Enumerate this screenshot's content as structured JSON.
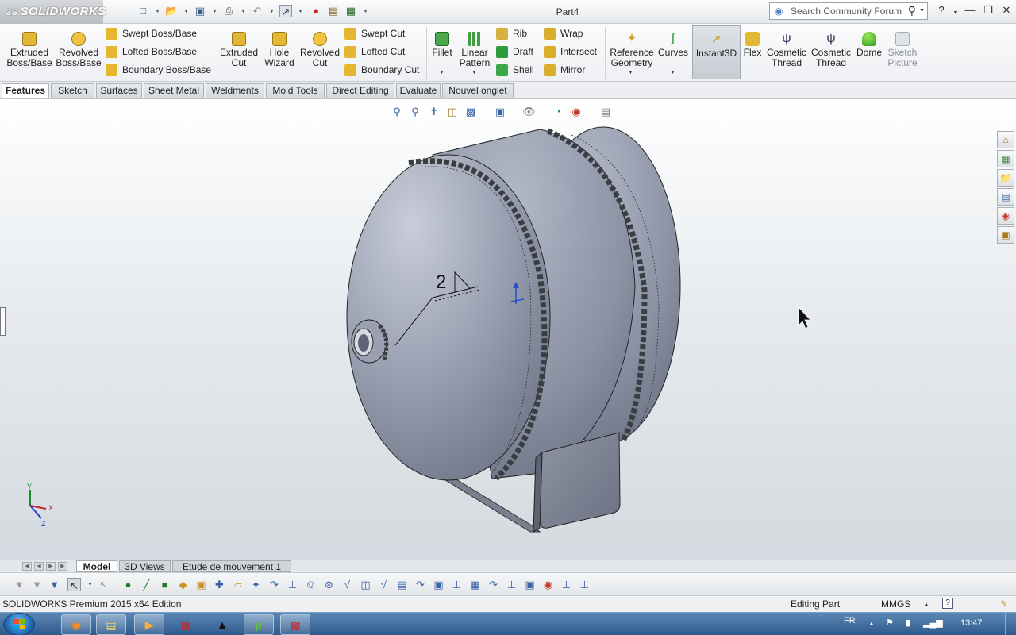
{
  "app": {
    "logo_text": "SOLIDWORKS",
    "logo_prefix": "3S",
    "document_title": "Part4",
    "search_placeholder": "Search Community Forum"
  },
  "ribbon": {
    "big_buttons": [
      {
        "id": "extruded-boss-base",
        "label": "Extruded\nBoss/Base"
      },
      {
        "id": "revolved-boss-base",
        "label": "Revolved\nBoss/Base"
      },
      {
        "id": "extruded-cut",
        "label": "Extruded\nCut"
      },
      {
        "id": "hole-wizard",
        "label": "Hole\nWizard"
      },
      {
        "id": "revolved-cut",
        "label": "Revolved\nCut"
      },
      {
        "id": "fillet",
        "label": "Fillet"
      },
      {
        "id": "linear-pattern",
        "label": "Linear\nPattern"
      },
      {
        "id": "reference-geometry",
        "label": "Reference\nGeometry"
      },
      {
        "id": "curves",
        "label": "Curves"
      },
      {
        "id": "instant3d",
        "label": "Instant3D"
      },
      {
        "id": "flex",
        "label": "Flex"
      },
      {
        "id": "cosmetic-thread-1",
        "label": "Cosmetic\nThread"
      },
      {
        "id": "cosmetic-thread-2",
        "label": "Cosmetic\nThread"
      },
      {
        "id": "dome",
        "label": "Dome"
      },
      {
        "id": "sketch-picture",
        "label": "Sketch\nPicture"
      }
    ],
    "small_buttons": {
      "swept_boss": "Swept Boss/Base",
      "lofted_boss": "Lofted Boss/Base",
      "boundary_boss": "Boundary Boss/Base",
      "swept_cut": "Swept Cut",
      "lofted_cut": "Lofted Cut",
      "boundary_cut": "Boundary Cut",
      "rib": "Rib",
      "draft": "Draft",
      "shell": "Shell",
      "wrap": "Wrap",
      "intersect": "Intersect",
      "mirror": "Mirror"
    }
  },
  "tabs": [
    "Features",
    "Sketch",
    "Surfaces",
    "Sheet Metal",
    "Weldments",
    "Mold Tools",
    "Direct Editing",
    "Evaluate",
    "Nouvel onglet"
  ],
  "active_tab": "Features",
  "viewport": {
    "weld_symbol_number": "2",
    "triad": {
      "x": "X",
      "y": "Y",
      "z": "Z"
    }
  },
  "model_tabs": [
    "Model",
    "3D Views",
    "Etude de mouvement 1"
  ],
  "status": {
    "edition": "SOLIDWORKS Premium 2015 x64 Edition",
    "mode": "Editing Part",
    "units": "MMGS"
  },
  "taskbar": {
    "language": "FR",
    "time": "13:47",
    "apps": [
      "firefox",
      "explorer",
      "media-player",
      "solidworks-2015",
      "acrobat",
      "utorrent",
      "solidworks-2015-b"
    ]
  },
  "colors": {
    "part_body": "#8e96a6",
    "part_highlight": "#c3c8d5",
    "weld_bead": "#3a3d42",
    "viewport_top": "#ffffff",
    "viewport_bottom": "#d4dadf",
    "taskbar": "#3e6a9d"
  }
}
